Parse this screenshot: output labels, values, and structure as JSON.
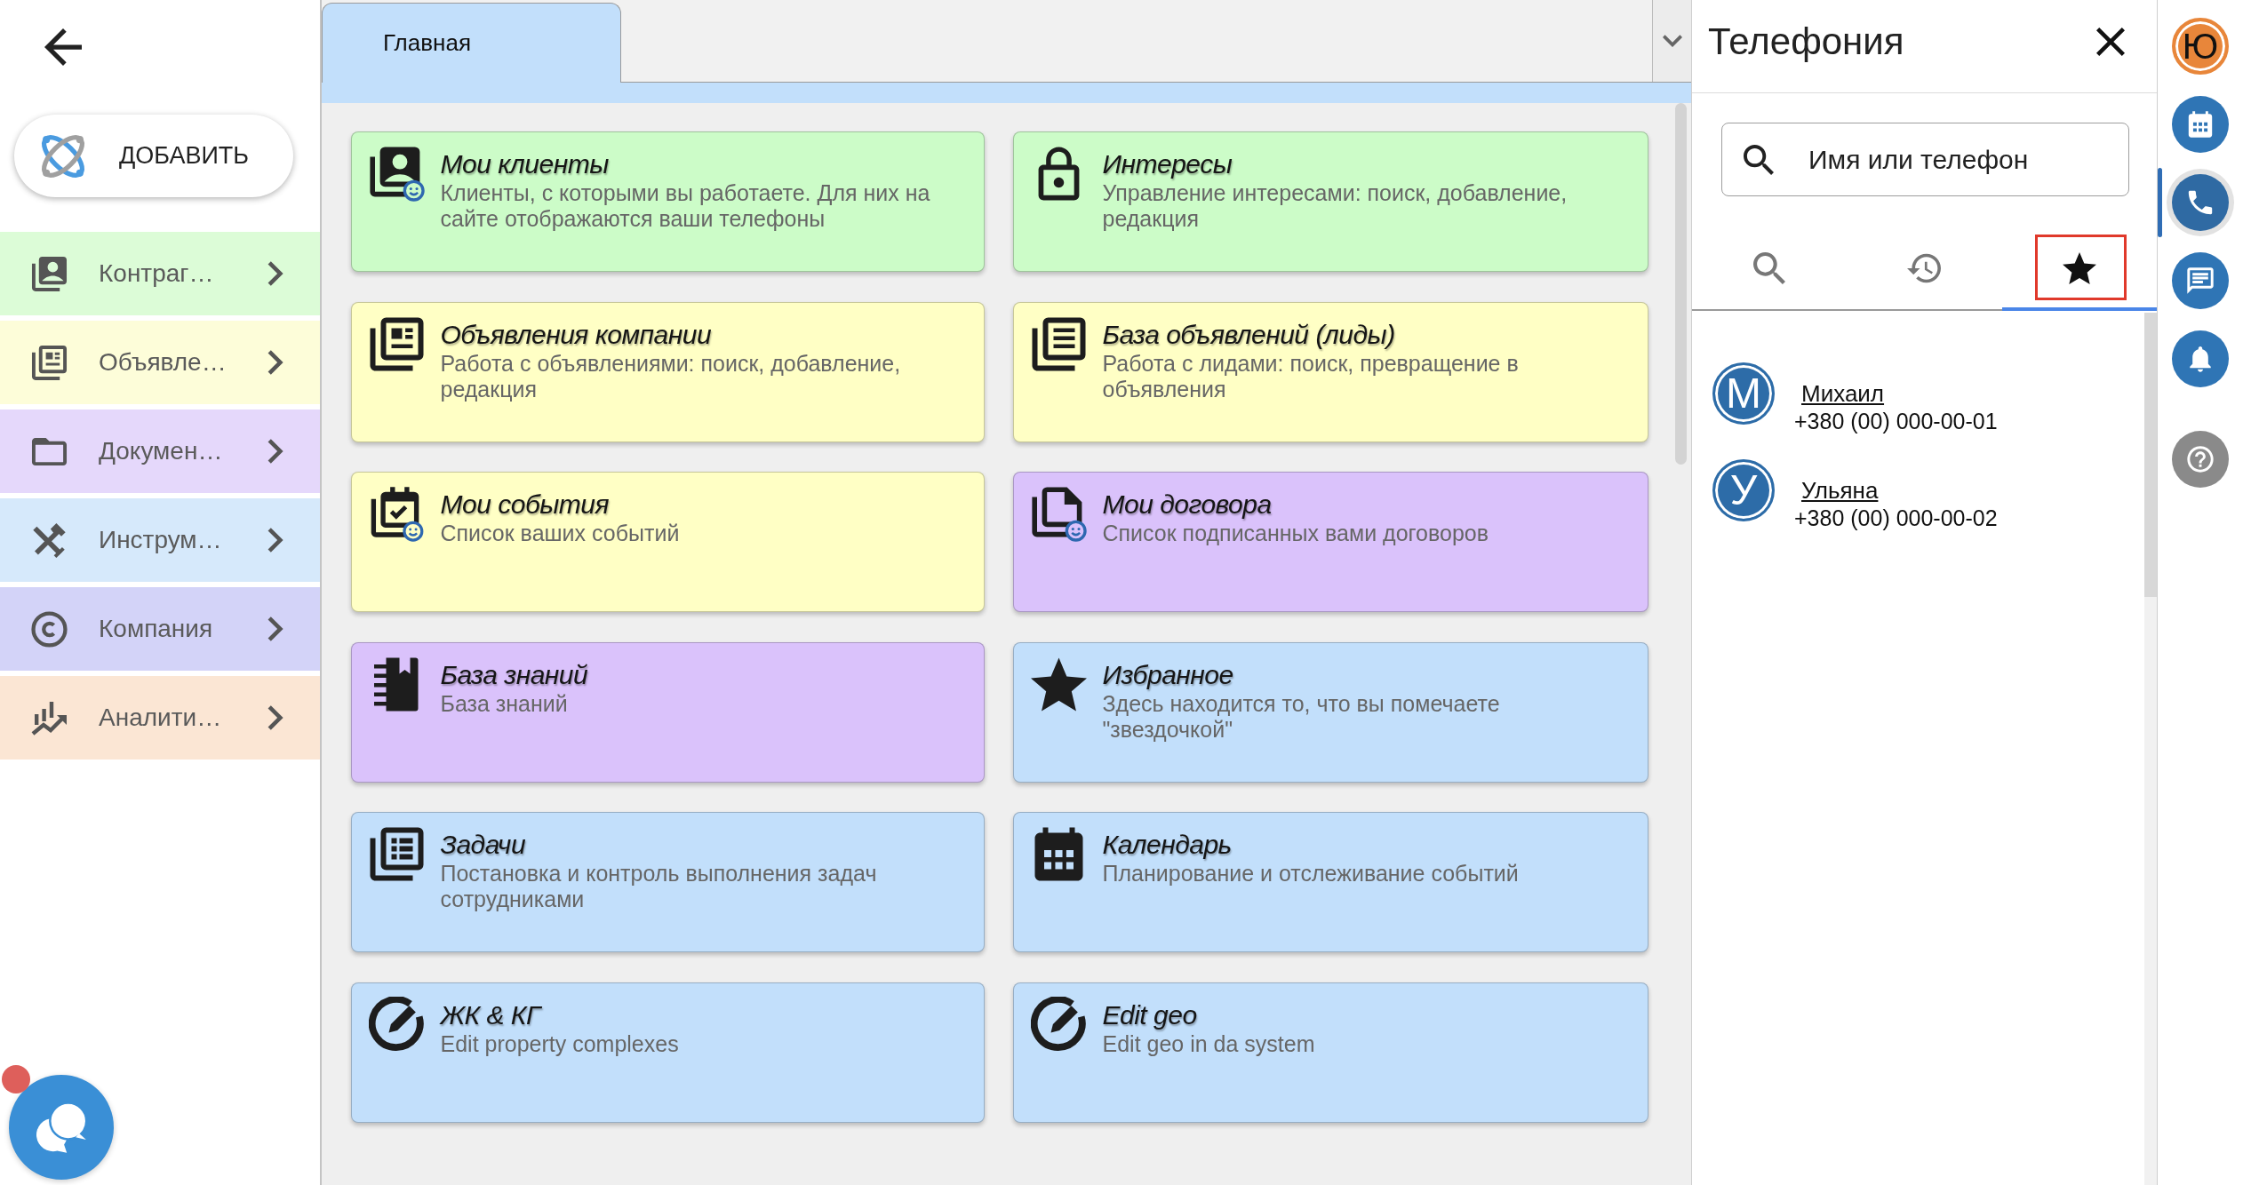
{
  "sidebar": {
    "add_button": {
      "label": "ДОБАВИТЬ"
    },
    "items": [
      {
        "label": "Контраг…",
        "color": "#dcfcd7"
      },
      {
        "label": "Объявле…",
        "color": "#fdfdd9"
      },
      {
        "label": "Докумен…",
        "color": "#e5d8fb"
      },
      {
        "label": "Инструм…",
        "color": "#d6e9fb"
      },
      {
        "label": "Компания",
        "color": "#d3d3f8"
      },
      {
        "label": "Аналити…",
        "color": "#fbe6d4"
      }
    ]
  },
  "tabs": [
    {
      "label": "Главная",
      "selected": true
    }
  ],
  "cards": [
    {
      "title": "Мои клиенты",
      "description": "Клиенты, с которыми вы работаете. Для них на сайте отображаются ваши телефоны",
      "color": "#ccfcc8"
    },
    {
      "title": "Интересы",
      "description": "Управление интересами: поиск, добавление, редакция",
      "color": "#ccfcc8"
    },
    {
      "title": "Объявления компании",
      "description": "Работа с объявлениями: поиск, добавление, редакция",
      "color": "#ffffc5"
    },
    {
      "title": "База объявлений (лиды)",
      "description": "Работа с лидами: поиск, превращение в объявления",
      "color": "#ffffc5"
    },
    {
      "title": "Мои события",
      "description": "Список ваших событий",
      "color": "#ffffc5"
    },
    {
      "title": "Мои договора",
      "description": "Список подписанных вами договоров",
      "color": "#dac2fb"
    },
    {
      "title": "База знаний",
      "description": "База знаний",
      "color": "#dac2fb"
    },
    {
      "title": "Избранное",
      "description": "Здесь находится то, что вы помечаете \"звездочкой\"",
      "color": "#c2dffb"
    },
    {
      "title": "Задачи",
      "description": "Постановка и контроль выполнения задач сотрудниками",
      "color": "#c2dffb"
    },
    {
      "title": "Календарь",
      "description": "Планирование и отслеживание событий",
      "color": "#c2dffb"
    },
    {
      "title": "ЖК & КГ",
      "description": "Edit property complexes",
      "color": "#c2dffb"
    },
    {
      "title": "Edit geo",
      "description": "Edit geo in da system",
      "color": "#c2dffb"
    }
  ],
  "telephony": {
    "title": "Телефония",
    "search": {
      "placeholder": "Имя или телефон"
    },
    "tabs": [
      {
        "selected": false,
        "highlighted": false
      },
      {
        "selected": false,
        "highlighted": false
      },
      {
        "selected": true,
        "highlighted": true
      }
    ],
    "contacts": [
      {
        "initial": "М",
        "name": "Михаил",
        "phone": "+380 (00) 000-00-01"
      },
      {
        "initial": "У",
        "name": "Ульяна",
        "phone": "+380 (00) 000-00-02"
      }
    ]
  },
  "rail": {
    "user": {
      "initial": "Ю"
    },
    "items": [
      {
        "kind": "calendar",
        "selected": false
      },
      {
        "kind": "phone",
        "selected": true
      },
      {
        "kind": "chat",
        "selected": false
      },
      {
        "kind": "notifications",
        "selected": false
      },
      {
        "kind": "help",
        "selected": false
      }
    ]
  }
}
